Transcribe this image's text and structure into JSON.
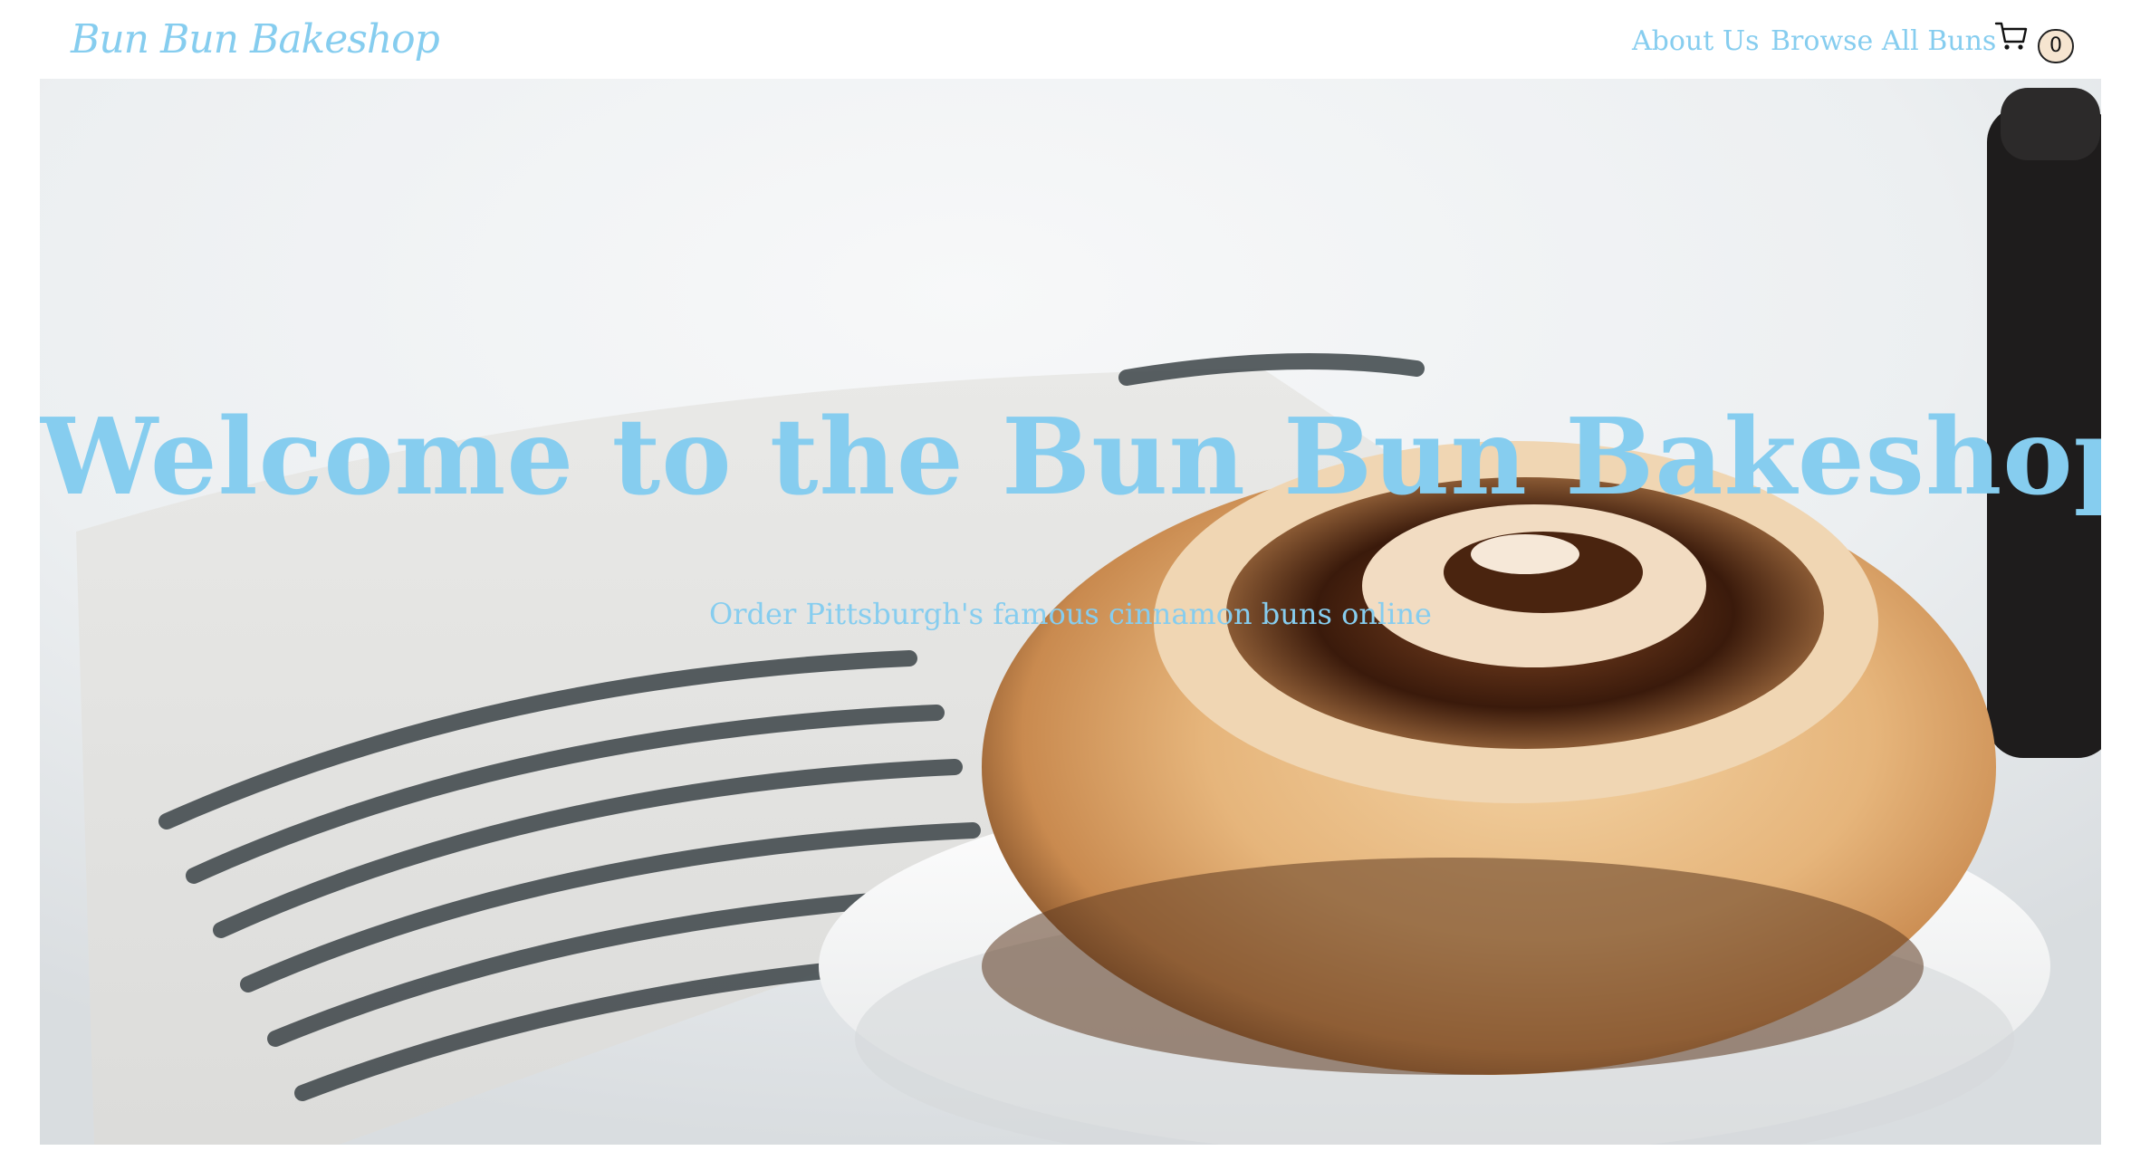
{
  "header": {
    "logo_text": "Bun Bun Bakeshop",
    "nav": {
      "about_label": "About Us",
      "browse_label": "Browse All Buns"
    },
    "cart": {
      "icon": "shopping-cart-icon",
      "count": "0"
    }
  },
  "hero": {
    "title": "Welcome to the Bun Bun Bakeshop",
    "subtitle": "Order Pittsburgh's famous cinnamon buns online",
    "image": "cinnamon-bun-on-plate-with-striped-towel"
  },
  "colors": {
    "accent": "#86cdef",
    "cart_badge_bg": "#f6e5d0",
    "cart_badge_border": "#222222",
    "page_bg": "#ffffff"
  }
}
